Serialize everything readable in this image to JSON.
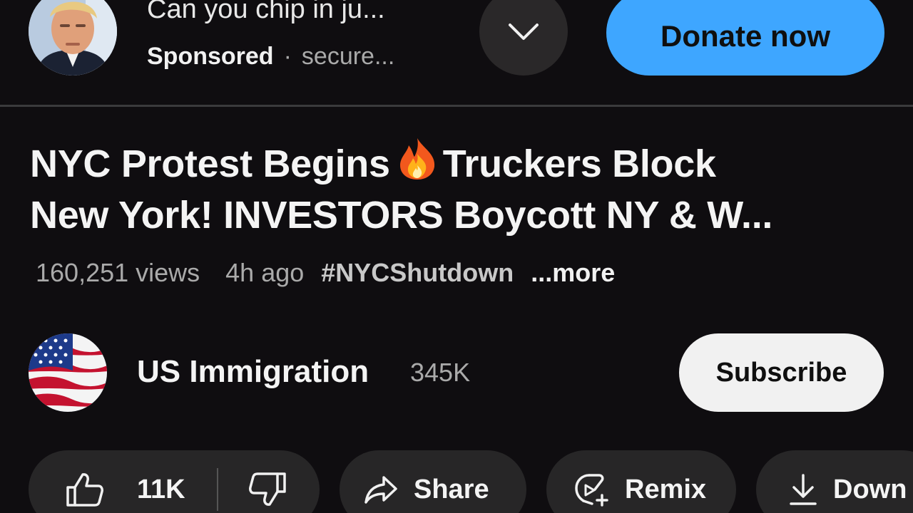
{
  "ad": {
    "headline": "Can you chip in ju...",
    "sponsored_label": "Sponsored",
    "separator": "·",
    "domain": "secure...",
    "cta_label": "Donate now",
    "accent_color": "#3ea6ff"
  },
  "video": {
    "title_line1_a": "NYC Protest Begins",
    "title_line1_b": "Truckers Block",
    "title_line2": "New York! INVESTORS Boycott NY & W...",
    "views": "160,251 views",
    "age": "4h ago",
    "hashtag": "#NYCShutdown",
    "more_label": "...more"
  },
  "channel": {
    "name": "US Immigration",
    "subscribers": "345K",
    "subscribe_label": "Subscribe"
  },
  "actions": {
    "like_count": "11K",
    "share_label": "Share",
    "remix_label": "Remix",
    "download_label": "Down"
  },
  "icons": {
    "fire": "fire-emoji-icon",
    "chevron": "chevron-down-icon",
    "like": "thumbs-up-icon",
    "dislike": "thumbs-down-icon",
    "share": "share-arrow-icon",
    "remix": "remix-icon",
    "download": "download-icon"
  }
}
